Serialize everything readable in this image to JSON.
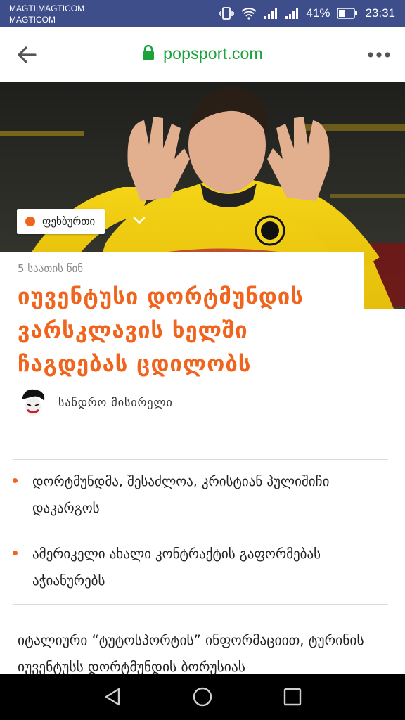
{
  "status_bar": {
    "carrier_line1": "MAGTI|MAGTICOM",
    "carrier_line2": "MAGTICOM",
    "battery_percent": "41%",
    "time": "23:31"
  },
  "browser": {
    "url": "popsport.com",
    "icons": [
      "back-arrow-icon",
      "lock-icon",
      "more-vert-icon"
    ]
  },
  "article": {
    "category": "ფეხბურთი",
    "time_ago": "5 საათის წინ",
    "headline": "იუვენტუსი დორტმუნდის ვარსკლავის ხელში ჩაგდებას ცდილობს",
    "author": "სანდრო მისირელი",
    "bullets": [
      "დორტმუნდმა, შესაძლოა, კრისტიან პულიშიჩი დაკარგოს",
      "ამერიკელი ახალი კონტრაქტის გაფორმებას აჭიანურებს"
    ],
    "body": "იტალიური “ტუტოსპორტის” ინფორმაციით, ტურინის იუვენტუსს დორტმუნდის ბორუსიას"
  },
  "colors": {
    "accent": "#f0641e",
    "status_bar": "#3d4e8a",
    "url_green": "#1aa33a"
  }
}
